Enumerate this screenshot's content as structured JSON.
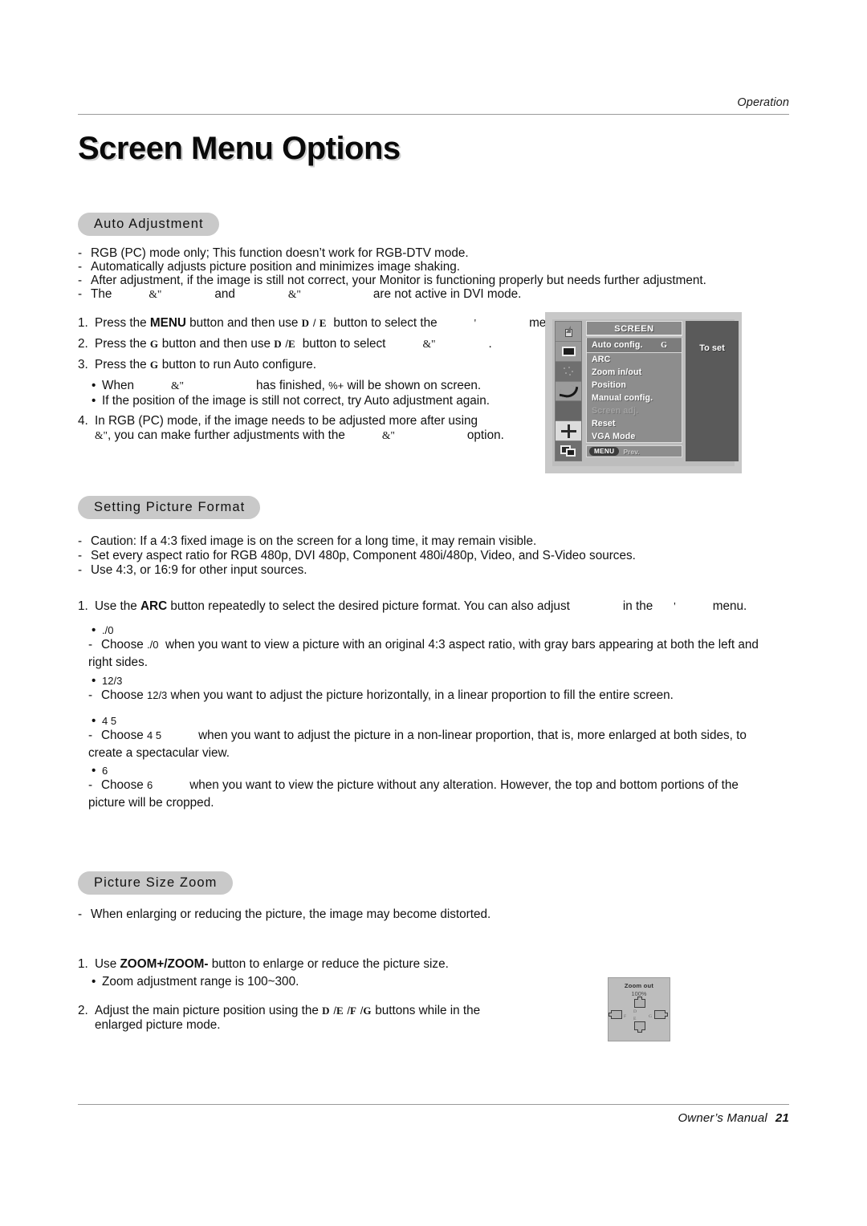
{
  "header": {
    "running_head": "Operation"
  },
  "page_title": "Screen Menu Options",
  "sections": {
    "auto_adjustment": {
      "heading": "Auto Adjustment",
      "bullets": [
        "RGB (PC) mode only; This function doesn’t work for RGB-DTV mode.",
        "Automatically adjusts picture position and minimizes image shaking.",
        "After adjustment, if the image is still not correct, your Monitor is functioning properly but needs further adjustment."
      ],
      "bullet4": {
        "pre": "The",
        "glyph1": "&\"",
        "mid": "and",
        "glyph2": "&\"",
        "post": "are not active in DVI mode."
      },
      "steps": [
        {
          "num": "1.",
          "a": "Press the",
          "bold": "MENU",
          "b": "button and then use",
          "g1": "D",
          "slash": "/",
          "g2": "E",
          "c": "button to select the",
          "g3": "'",
          "d": "menu."
        },
        {
          "num": "2.",
          "a": "Press the",
          "g0": "G",
          "b": "button and then use",
          "g1": "D",
          "slash": "/",
          "g2": "E",
          "c": "button to select",
          "g3": "&\"",
          "d": "."
        },
        {
          "num": "3.",
          "a": "Press the",
          "g0": "G",
          "b": "button to run Auto configure."
        }
      ],
      "sub_bullets": [
        {
          "a": "When",
          "g1": "&\"",
          "b": "has finished,",
          "g2": "%+",
          "c": "will be shown on screen."
        },
        {
          "a": "If the position of the image is still not correct, try Auto adjustment again."
        }
      ],
      "step4": {
        "num": "4.",
        "line1": "In RGB (PC) mode, if the image needs to be adjusted more after using",
        "g1": "&\"",
        "line2a": ", you can make further adjustments with the",
        "g2": "&\"",
        "line2b": "option."
      },
      "osd": {
        "title": "SCREEN",
        "right_panel_text": "To set",
        "items": [
          {
            "label": "Auto config.",
            "right_glyph": "G",
            "state": "selected"
          },
          {
            "label": "ARC",
            "right_glyph": "",
            "state": "normal"
          },
          {
            "label": "Zoom in/out",
            "right_glyph": "",
            "state": "normal"
          },
          {
            "label": "Position",
            "right_glyph": "",
            "state": "normal"
          },
          {
            "label": "Manual config.",
            "right_glyph": "",
            "state": "normal"
          },
          {
            "label": "Screen adj.",
            "right_glyph": "",
            "state": "dimmed"
          },
          {
            "label": "Reset",
            "right_glyph": "",
            "state": "normal"
          },
          {
            "label": "VGA Mode",
            "right_glyph": "",
            "state": "normal"
          }
        ],
        "footer_button": "MENU",
        "footer_label": "Prev.",
        "icons": [
          "speaker-icon",
          "picture-icon",
          "dots-icon",
          "curve-icon",
          "blank-icon",
          "four-arrows-icon",
          "pip-icon"
        ]
      }
    },
    "setting_picture_format": {
      "heading": "Setting Picture Format",
      "bullets": [
        "Caution: If a 4:3 fixed image is on the screen for a long time, it may remain visible.",
        "Set every aspect ratio for RGB 480p, DVI 480p, Component 480i/480p, Video, and S-Video sources.",
        "Use 4:3, or 16:9 for other input sources."
      ],
      "step1": {
        "num": "1.",
        "a": "Use the",
        "bold": "ARC",
        "b": "button repeatedly to select the desired picture format. You can also adjust",
        "c": "in the",
        "g1": "'",
        "d": "menu."
      },
      "formats": [
        {
          "bullet_glyph": "./0",
          "desc_pre": "Choose",
          "desc_glyph": "./0",
          "desc_post": "when you want to view a picture with an original 4:3 aspect ratio, with gray bars appearing at both the left and right sides."
        },
        {
          "bullet_glyph": "12/3",
          "desc_pre": "Choose",
          "desc_glyph": "12/3",
          "desc_post": "when you want to adjust the picture horizontally, in a linear proportion to fill the entire screen."
        },
        {
          "bullet_glyph": "4  5",
          "desc_pre": "Choose",
          "desc_glyph": "4  5",
          "desc_post": "when you want to adjust the picture in a non-linear proportion, that is, more enlarged at both sides, to create a spectacular view."
        },
        {
          "bullet_glyph": "6",
          "desc_pre": "Choose",
          "desc_glyph": "6",
          "desc_post": "when you want to view the picture without any alteration. However, the top and bottom portions of the picture will be cropped."
        }
      ]
    },
    "picture_size_zoom": {
      "heading": "Picture Size Zoom",
      "bullets": [
        "When enlarging or reducing the picture, the image may become distorted."
      ],
      "step1": {
        "num": "1.",
        "a": "Use",
        "bold": "ZOOM+/ZOOM-",
        "b": "button to enlarge or reduce the picture size."
      },
      "sub_bullet": "Zoom adjustment range is 100~300.",
      "step2": {
        "num": "2.",
        "a": "Adjust the main picture position using the",
        "g1": "D",
        "s1": "/",
        "g2": "E",
        "s2": "/",
        "g3": "F",
        "s3": "/",
        "g4": "G",
        "b": "buttons while in the",
        "line2": "enlarged picture mode."
      },
      "zoom_osd": {
        "title": "Zoom out",
        "percent": "100%",
        "label_d": "D",
        "label_g": "G",
        "label_e": "E",
        "label_f": "F"
      }
    }
  },
  "footer": {
    "manual_label": "Owner’s Manual",
    "page_number": "21"
  },
  "colors": {
    "pill_bg": "#c9c9c9",
    "osd_frame": "#c8c8c8",
    "osd_menu_bg": "#8d8d8d",
    "osd_right_panel": "#5a5a5a",
    "rule": "#9a9a9a"
  }
}
